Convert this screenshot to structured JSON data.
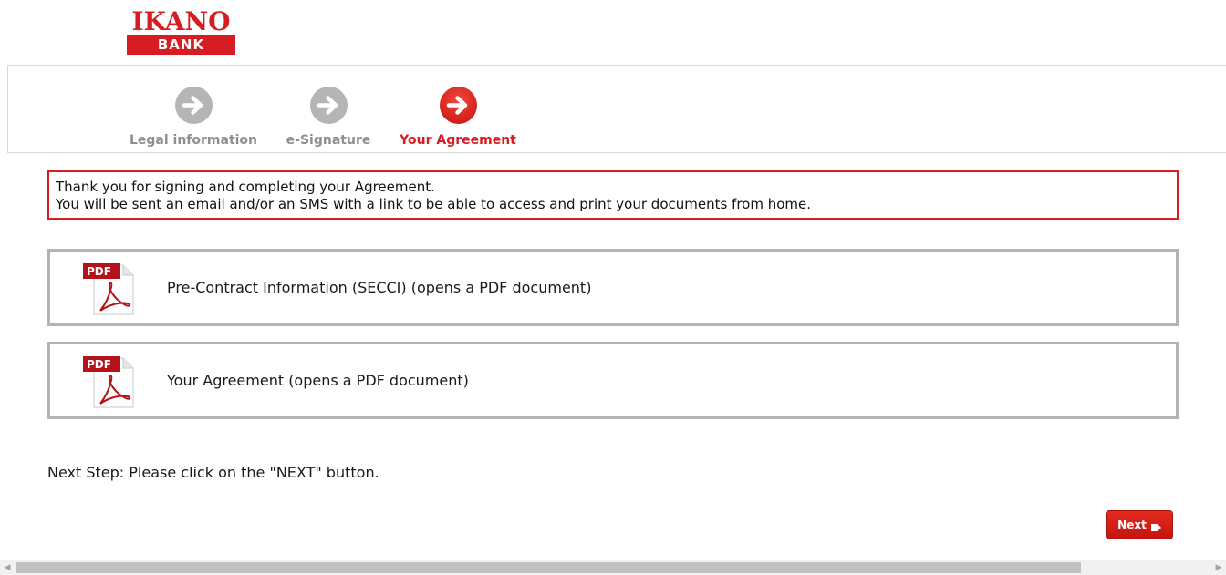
{
  "brand": {
    "logo_top": "IKANO",
    "logo_bottom": "BANK",
    "color": "#d71d24"
  },
  "steps": [
    {
      "label": "Legal information",
      "state": "done",
      "icon": "arrow-right-circle-icon"
    },
    {
      "label": "e-Signature",
      "state": "done",
      "icon": "arrow-right-circle-icon"
    },
    {
      "label": "Your Agreement",
      "state": "active",
      "icon": "arrow-right-circle-icon"
    }
  ],
  "notice": {
    "line1": "Thank you for signing and completing your Agreement.",
    "line2": "You will be sent an email and/or an SMS with a link to be able to access and print your documents from home."
  },
  "documents": [
    {
      "label": "Pre-Contract Information (SECCI) (opens a PDF document)",
      "icon": "pdf-icon",
      "icon_text": "PDF"
    },
    {
      "label": "Your Agreement (opens a PDF document)",
      "icon": "pdf-icon",
      "icon_text": "PDF"
    }
  ],
  "next_step_text": "Next Step: Please click on the \"NEXT\" button.",
  "next_button": {
    "label": "Next",
    "icon": "tag-arrow-icon"
  },
  "colors": {
    "accent": "#d71d24",
    "step_done": "#b5b5b5",
    "card_border": "#b3b3b3"
  }
}
